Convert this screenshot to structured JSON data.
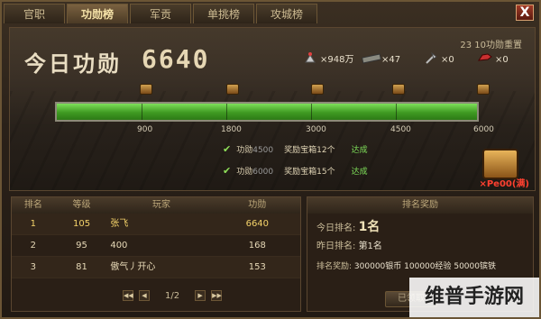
{
  "tabs": [
    {
      "label": "官职"
    },
    {
      "label": "功勋榜"
    },
    {
      "label": "军贡"
    },
    {
      "label": "单挑榜"
    },
    {
      "label": "攻城榜"
    }
  ],
  "close_label": "X",
  "header": {
    "title": "今日功勋",
    "value": "6640",
    "reset_note": "23 10功勋重置"
  },
  "stats": [
    {
      "icon": "silver-ingot-icon",
      "value": "×948万"
    },
    {
      "icon": "troops-icon",
      "value": "×47"
    },
    {
      "icon": "axe-icon",
      "value": "×0"
    },
    {
      "icon": "war-horse-icon",
      "value": "×0"
    }
  ],
  "progress": {
    "current": 6640,
    "max": 6000,
    "ticks": [
      "900",
      "1800",
      "3000",
      "4500",
      "6000"
    ]
  },
  "tasks": [
    {
      "label": "功勋",
      "current": "4500",
      "reward": "奖励宝箱12个",
      "status": "达成"
    },
    {
      "label": "功勋",
      "current": "6000",
      "reward": "奖励宝箱15个",
      "status": "达成"
    }
  ],
  "chest": {
    "label": "×Pe00(满)"
  },
  "ranking_table": {
    "headers": [
      "排名",
      "等级",
      "玩家",
      "功勋"
    ],
    "rows": [
      {
        "rank": "1",
        "level": "105",
        "player": "张飞",
        "merit": "6640"
      },
      {
        "rank": "2",
        "level": "95",
        "player": "400",
        "merit": "168"
      },
      {
        "rank": "3",
        "level": "81",
        "player": "傲气丿开心",
        "merit": "153"
      }
    ],
    "pager": {
      "prev_first": "◀◀",
      "prev": "◀",
      "page": "1/2",
      "next": "▶",
      "next_last": "▶▶"
    }
  },
  "reward_panel": {
    "title": "排名奖励",
    "today_label": "今日排名:",
    "today_value": "1名",
    "yesterday_label": "昨日排名:",
    "yesterday_value": "第1名",
    "reward_label": "排名奖励:",
    "reward_value": "300000银币 100000经验 50000镔铁",
    "claim_label": "已领取"
  },
  "watermark": "维普手游网"
}
